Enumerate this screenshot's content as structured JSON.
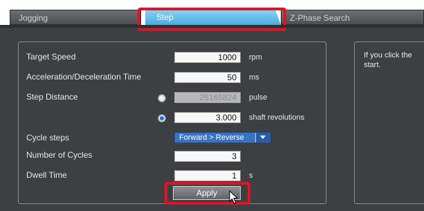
{
  "tabs": {
    "jogging": "Jogging",
    "step": "Step",
    "zphase": "Z-Phase Search",
    "active": "Step"
  },
  "form": {
    "target_speed": {
      "label": "Target Speed",
      "value": "1000",
      "unit": "rpm"
    },
    "accel_time": {
      "label": "Acceleration/Deceleration Time",
      "value": "50",
      "unit": "ms"
    },
    "step_distance": {
      "label": "Step Distance",
      "pulse_value": "25165824",
      "pulse_unit": "pulse",
      "rev_value": "3.000",
      "rev_unit": "shaft revolutions",
      "selected": "shaft revolutions"
    },
    "cycle_steps": {
      "label": "Cycle steps",
      "value": "Forward > Reverse"
    },
    "num_cycles": {
      "label": "Number of Cycles",
      "value": "3"
    },
    "dwell_time": {
      "label": "Dwell Time",
      "value": "1",
      "unit": "s"
    },
    "apply_label": "Apply"
  },
  "info": {
    "text": "If you click the start."
  },
  "colors": {
    "highlight": "#e01225",
    "active_tab": "#46aee0",
    "panel_bg": "#3d3f42"
  }
}
